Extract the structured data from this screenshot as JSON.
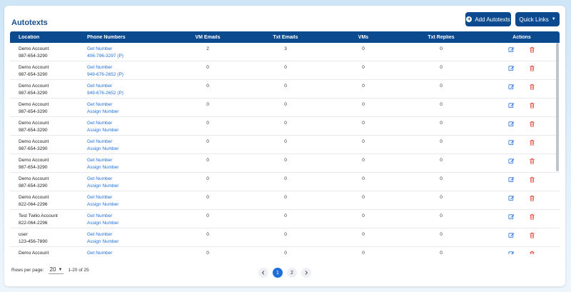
{
  "header": {
    "title": "Autotexts",
    "add_label": "Add Autotexts",
    "quick_links_label": "Quick Links"
  },
  "table": {
    "columns": [
      "Location",
      "Phone Numbers",
      "VM Emails",
      "Txt Emails",
      "VMs",
      "Txt Replies",
      "Actions"
    ],
    "rows": [
      {
        "loc": "Demo Account",
        "phone": "987-654-3290",
        "l1": "Get Number",
        "l2": "406-796-3297 (P)",
        "vm": "2",
        "txt": "3",
        "vms": "0",
        "rep": "0"
      },
      {
        "loc": "Demo Account",
        "phone": "987-654-3290",
        "l1": "Get Number",
        "l2": "949-676-2652 (P)",
        "vm": "0",
        "txt": "0",
        "vms": "0",
        "rep": "0"
      },
      {
        "loc": "Demo Account",
        "phone": "987-654-3290",
        "l1": "Get Number",
        "l2": "949-676-2652 (P)",
        "vm": "0",
        "txt": "0",
        "vms": "0",
        "rep": "0"
      },
      {
        "loc": "Demo Account",
        "phone": "987-654-3290",
        "l1": "Get Number",
        "l2": "Assign Number",
        "vm": "0",
        "txt": "0",
        "vms": "0",
        "rep": "0"
      },
      {
        "loc": "Demo Account",
        "phone": "987-654-3290",
        "l1": "Get Number",
        "l2": "Assign Number",
        "vm": "0",
        "txt": "0",
        "vms": "0",
        "rep": "0"
      },
      {
        "loc": "Demo Account",
        "phone": "987-654-3290",
        "l1": "Get Number",
        "l2": "Assign Number",
        "vm": "0",
        "txt": "0",
        "vms": "0",
        "rep": "0"
      },
      {
        "loc": "Demo Account",
        "phone": "987-654-3290",
        "l1": "Get Number",
        "l2": "Assign Number",
        "vm": "0",
        "txt": "0",
        "vms": "0",
        "rep": "0"
      },
      {
        "loc": "Demo Account",
        "phone": "987-654-3290",
        "l1": "Get Number",
        "l2": "Assign Number",
        "vm": "0",
        "txt": "0",
        "vms": "0",
        "rep": "0"
      },
      {
        "loc": "Demo Account",
        "phone": "822-064-2296",
        "l1": "Get Number",
        "l2": "Assign Number",
        "vm": "0",
        "txt": "0",
        "vms": "0",
        "rep": "0"
      },
      {
        "loc": "Test Twilio Account",
        "phone": "822-064-2296",
        "l1": "Get Number",
        "l2": "Assign Number",
        "vm": "0",
        "txt": "0",
        "vms": "0",
        "rep": "0"
      },
      {
        "loc": "user",
        "phone": "123-456-7890",
        "l1": "Get Number",
        "l2": "Assign Number",
        "vm": "0",
        "txt": "0",
        "vms": "0",
        "rep": "0"
      },
      {
        "loc": "Demo Account",
        "phone": "",
        "l1": "Get Number",
        "l2": "",
        "vm": "0",
        "txt": "0",
        "vms": "0",
        "rep": "0"
      }
    ]
  },
  "footer": {
    "rows_per_page_label": "Rows per page:",
    "rows_per_page_value": "20",
    "range_text": "1-20 of 25"
  },
  "pagination": {
    "pages": [
      "1",
      "2"
    ],
    "current": "1"
  },
  "colors": {
    "primary": "#0b4a8f",
    "link": "#1e6fd9",
    "edit": "#1e6fd9",
    "delete": "#e0443a"
  },
  "icons": {
    "add": "plus-circle-icon",
    "edit": "edit-icon",
    "delete": "trash-icon",
    "prev": "chevron-left-icon",
    "next": "chevron-right-icon",
    "dropdown": "caret-down-icon"
  }
}
